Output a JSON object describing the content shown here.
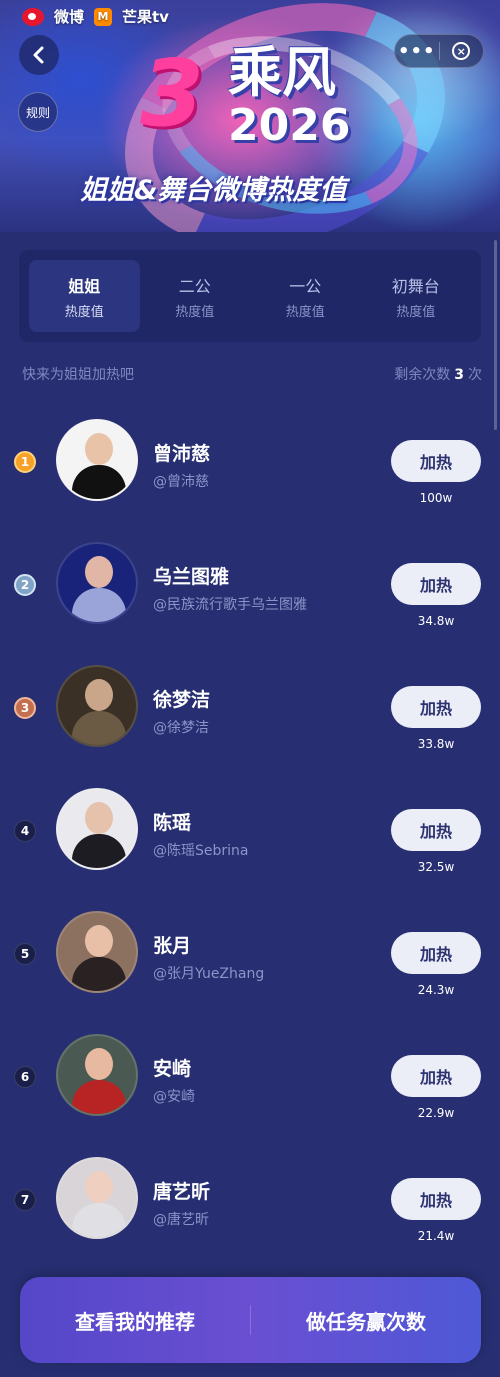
{
  "header": {
    "brand_weibo": "微博",
    "brand_mango": "芒果tv",
    "banner_number": "3",
    "banner_title": "乘风",
    "banner_year": "2026",
    "banner_subtitle": "姐姐&舞台微博热度值",
    "rules_label": "规则",
    "more_label": "•••",
    "close_label": "×"
  },
  "tabs": [
    {
      "title": "姐姐",
      "sub": "热度值",
      "active": true
    },
    {
      "title": "二公",
      "sub": "热度值",
      "active": false
    },
    {
      "title": "一公",
      "sub": "热度值",
      "active": false
    },
    {
      "title": "初舞台",
      "sub": "热度值",
      "active": false
    }
  ],
  "hint": {
    "left": "快来为姐姐加热吧",
    "right_prefix": "剩余次数",
    "count": "3",
    "right_suffix": "次"
  },
  "rankings": [
    {
      "rank": "1",
      "name": "曾沛慈",
      "handle": "@曾沛慈",
      "button": "加热",
      "heat": "100w"
    },
    {
      "rank": "2",
      "name": "乌兰图雅",
      "handle": "@民族流行歌手乌兰图雅",
      "button": "加热",
      "heat": "34.8w"
    },
    {
      "rank": "3",
      "name": "徐梦洁",
      "handle": "@徐梦洁",
      "button": "加热",
      "heat": "33.8w"
    },
    {
      "rank": "4",
      "name": "陈瑶",
      "handle": "@陈瑶Sebrina",
      "button": "加热",
      "heat": "32.5w"
    },
    {
      "rank": "5",
      "name": "张月",
      "handle": "@张月YueZhang",
      "button": "加热",
      "heat": "24.3w"
    },
    {
      "rank": "6",
      "name": "安崎",
      "handle": "@安崎",
      "button": "加热",
      "heat": "22.9w"
    },
    {
      "rank": "7",
      "name": "唐艺昕",
      "handle": "@唐艺昕",
      "button": "加热",
      "heat": "21.4w"
    }
  ],
  "bottom": {
    "left": "查看我的推荐",
    "right": "做任务赢次数"
  },
  "colors": {
    "background": "#272f72",
    "tab_panel": "#1f2766",
    "heat_button": "#eceef7",
    "accent_pink": "#ff3f9e",
    "bottom_gradient_start": "#5447c8",
    "bottom_gradient_end": "#4e59d6"
  }
}
